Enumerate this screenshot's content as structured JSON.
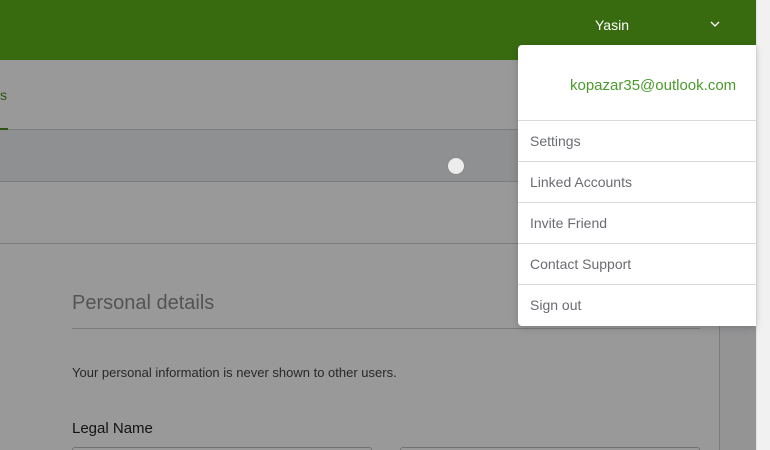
{
  "header": {
    "user_name": "Yasin",
    "chevron_icon": "chevron-down-icon",
    "background_color": "#386b10"
  },
  "subnav": {
    "visible_fragment": "s"
  },
  "main": {
    "section_title": "Personal details",
    "privacy_note": "Your personal information is never shown to other users.",
    "legal_name_label": "Legal Name"
  },
  "user_menu": {
    "email": "kopazar35@outlook.com",
    "items": [
      {
        "label": "Settings"
      },
      {
        "label": "Linked Accounts"
      },
      {
        "label": "Invite Friend"
      },
      {
        "label": "Contact Support"
      },
      {
        "label": "Sign out"
      }
    ],
    "accent_color": "#4b9a2c"
  }
}
